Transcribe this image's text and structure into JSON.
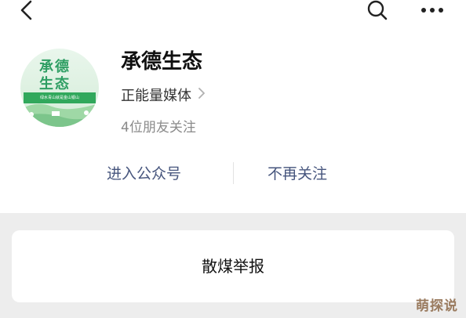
{
  "nav": {
    "back_icon": "chevron-left-icon",
    "search_icon": "search-icon",
    "more_icon": "ellipsis-icon"
  },
  "account": {
    "avatar_text_line1": "承德",
    "avatar_text_line2": "生态",
    "avatar_banner": "绿水青山就是金山银山",
    "name": "承德生态",
    "category": "正能量媒体",
    "followers": "4位朋友关注"
  },
  "actions": {
    "enter": "进入公众号",
    "unfollow": "不再关注"
  },
  "report": {
    "label": "散煤举报"
  },
  "watermark": "萌探说",
  "colors": {
    "link": "#46557d",
    "background": "#ededed",
    "avatar_green": "#2e9e63"
  }
}
